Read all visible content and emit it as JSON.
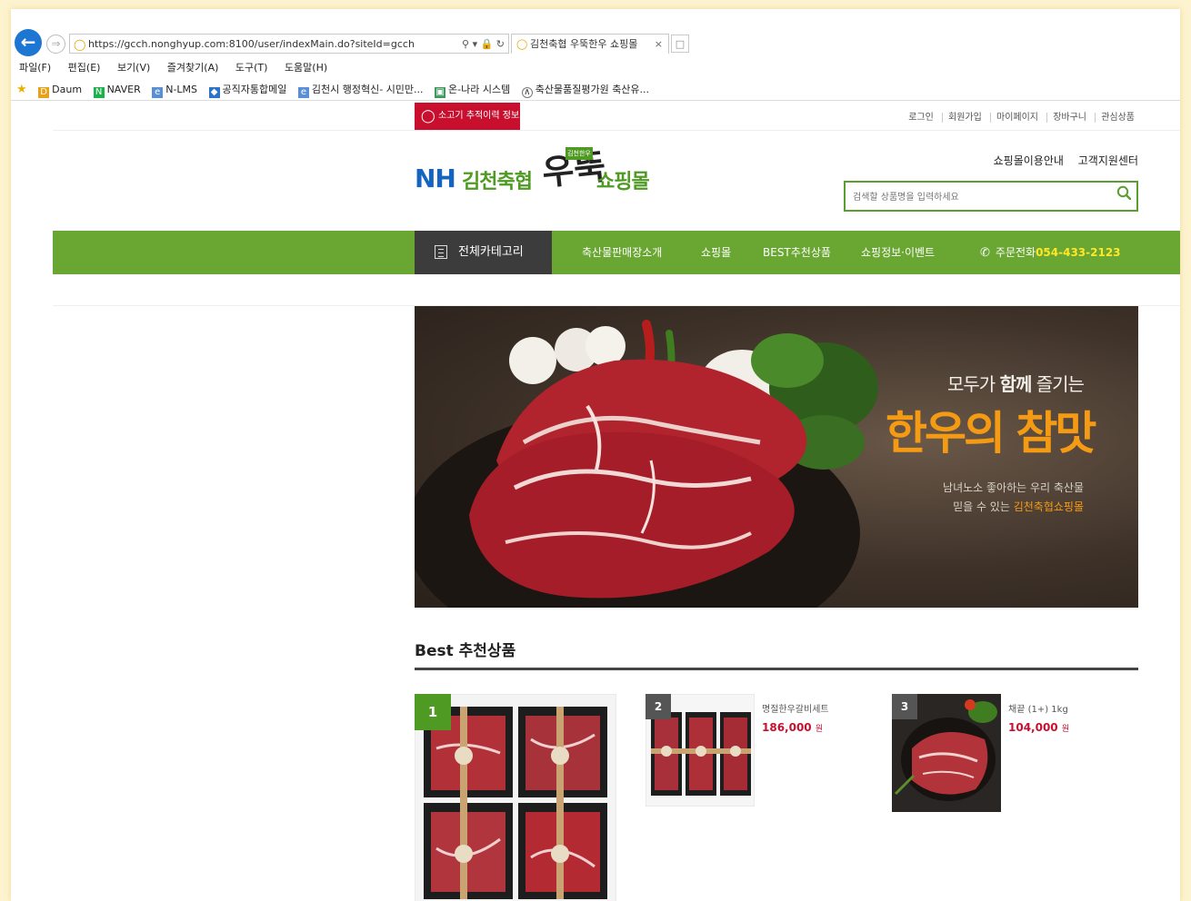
{
  "browser": {
    "url": "https://gcch.nonghyup.com:8100/user/indexMain.do?siteId=gcch",
    "tab_title": "김천축협 우뚝한우 쇼핑몰",
    "tab_close": "×",
    "menu": [
      "파일(F)",
      "편집(E)",
      "보기(V)",
      "즐겨찾기(A)",
      "도구(T)",
      "도움말(H)"
    ],
    "favorites": [
      "Daum",
      "NAVER",
      "N-LMS",
      "공직자통합메일",
      "김천시 행정혁신- 시민만...",
      "온-나라 시스템",
      "축산물품질평가원 축산유..."
    ]
  },
  "site": {
    "trace_badge": "소고기 추적이력 정보",
    "top_links": [
      "로그인",
      "회원가입",
      "마이페이지",
      "장바구니",
      "관심상품"
    ],
    "util_links": [
      "쇼핑몰이용안내",
      "고객지원센터"
    ],
    "logo": {
      "nh": "NH",
      "coop": "김천축협",
      "callig": "우뚝",
      "mall": "쇼핑몰",
      "stamp": "김천한우"
    },
    "search_placeholder": "검색할 상품명을 입력하세요",
    "nav": {
      "all_category": "전체카테고리",
      "items": [
        "축산물판매장소개",
        "쇼핑몰",
        "BEST추천상품",
        "쇼핑정보·이벤트"
      ],
      "phone_label": "주문전화",
      "phone_number": "054-433-2123"
    },
    "banner": {
      "line1_a": "모두가 ",
      "line1_b": "함께",
      "line1_c": " 즐기는",
      "line2": "한우의 참맛",
      "line3": "남녀노소 좋아하는 우리 축산물",
      "line4_a": "믿을 수 있는 ",
      "line4_b": "김천축협쇼핑몰"
    },
    "best": {
      "title": "Best 추천상품",
      "products": [
        {
          "rank": "1",
          "name": "",
          "price": ""
        },
        {
          "rank": "2",
          "name": "명절한우갈비세트",
          "price": "186,000",
          "unit": "원"
        },
        {
          "rank": "3",
          "name": "채끝 (1+) 1kg",
          "price": "104,000",
          "unit": "원"
        }
      ]
    }
  },
  "colors": {
    "nav_green": "#6aa632",
    "dark": "#3c3c3c",
    "accent_red": "#c8102e",
    "phone_yellow": "#ffe629",
    "banner_orange": "#f59b13",
    "rank1": "#4f9a22",
    "rank_other": "#555555"
  }
}
